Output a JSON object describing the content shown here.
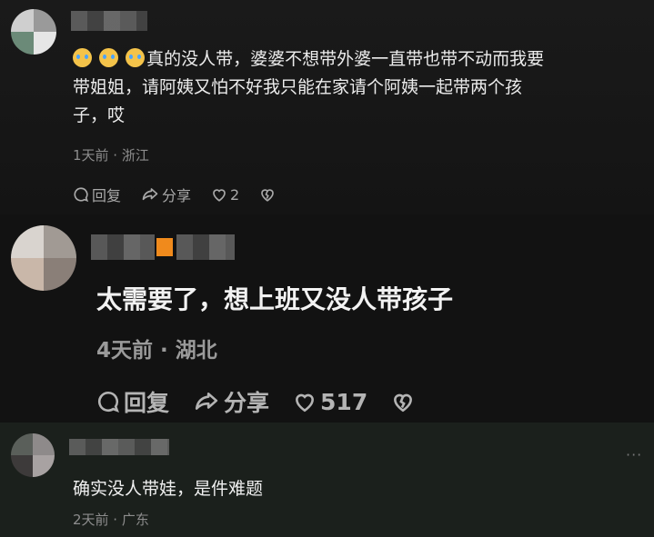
{
  "comments": [
    {
      "emojis": [
        "crying-face",
        "crying-face",
        "crying-face"
      ],
      "text_line1": "真的没人带，婆婆不想带外婆一直带也带不动而我要",
      "text_line2": "带姐姐，请阿姨又怕不好我只能在家请个阿姨一起带两个孩",
      "text_line3": "子，哎",
      "meta": "1天前 · 浙江",
      "reply_label": "回复",
      "share_label": "分享",
      "likes": "2"
    },
    {
      "text": "太需要了，想上班又没人带孩子",
      "meta": "4天前 · 湖北",
      "reply_label": "回复",
      "share_label": "分享",
      "likes": "517"
    },
    {
      "text": "确实没人带娃，是件难题",
      "meta": "2天前 · 广东",
      "more": "···"
    }
  ],
  "colors": {
    "accent_badge": "#f08a1c",
    "meta_text": "#8d8d8d",
    "emoji_yellow": "#f4c34a"
  }
}
